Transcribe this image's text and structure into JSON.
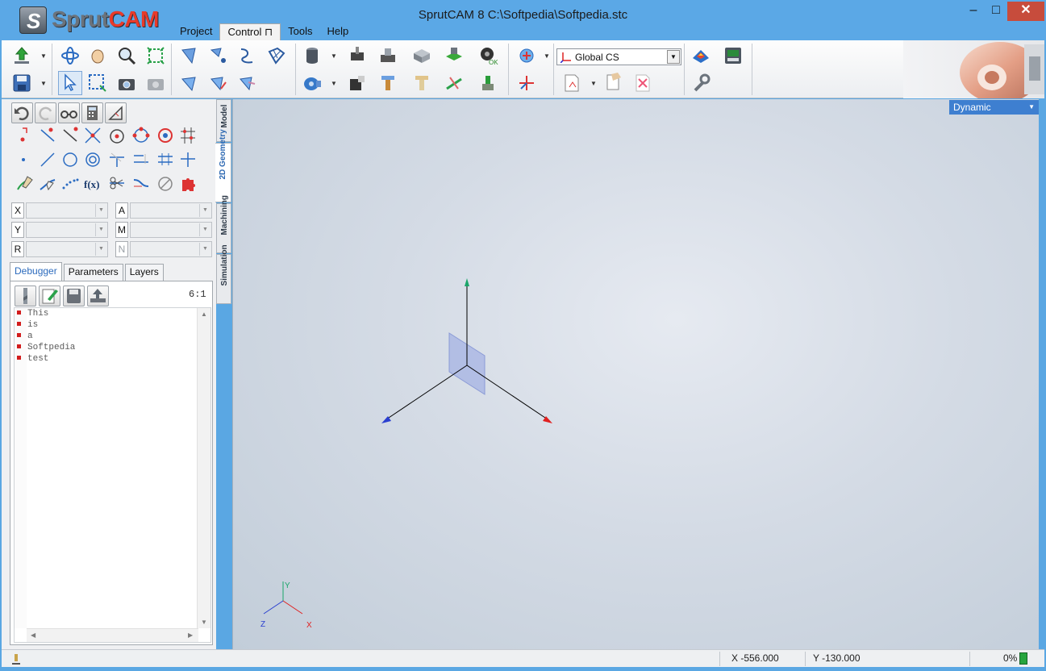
{
  "app": {
    "logo_alt": "SprutCAM logo",
    "logo_text_a": "Sprut",
    "logo_text_b": "CAM",
    "title": "SprutCAM 8   C:\\Softpedia\\Softpedia.stc",
    "window_controls": {
      "minimize": "–",
      "maximize": "□",
      "close": "✕"
    }
  },
  "menu": {
    "items": [
      {
        "label": "Project"
      },
      {
        "label": "Control ⊓"
      },
      {
        "label": "Tools"
      },
      {
        "label": "Help"
      }
    ]
  },
  "toolbar": {
    "coordinate_system": "Global CS"
  },
  "side_tabs": [
    "Model",
    "2D Geometry",
    "Machining",
    "Simulation"
  ],
  "fields": {
    "x_label": "X",
    "y_label": "Y",
    "r_label": "R",
    "a_label": "A",
    "m_label": "M",
    "n_label": "N",
    "x_value": "",
    "y_value": "",
    "r_value": "",
    "a_value": "",
    "m_value": "",
    "n_value": ""
  },
  "panel_tabs": [
    "Debugger",
    "Parameters",
    "Layers"
  ],
  "debugger": {
    "counter": "6:1",
    "lines": [
      "This",
      "is",
      "a",
      "Softpedia",
      "test"
    ]
  },
  "viewport": {
    "view_mode": "Dynamic",
    "axis_y": "Y",
    "axis_z": "Z",
    "axis_x": "X",
    "colors": {
      "x_axis": "#e02020",
      "y_axis": "#1aa56a",
      "z_axis": "#2a3fd0",
      "selection": "#3e7fd0"
    }
  },
  "status": {
    "x_coord": "X -556.000",
    "y_coord": "Y -130.000",
    "progress": "0%",
    "progress_value": 0
  }
}
